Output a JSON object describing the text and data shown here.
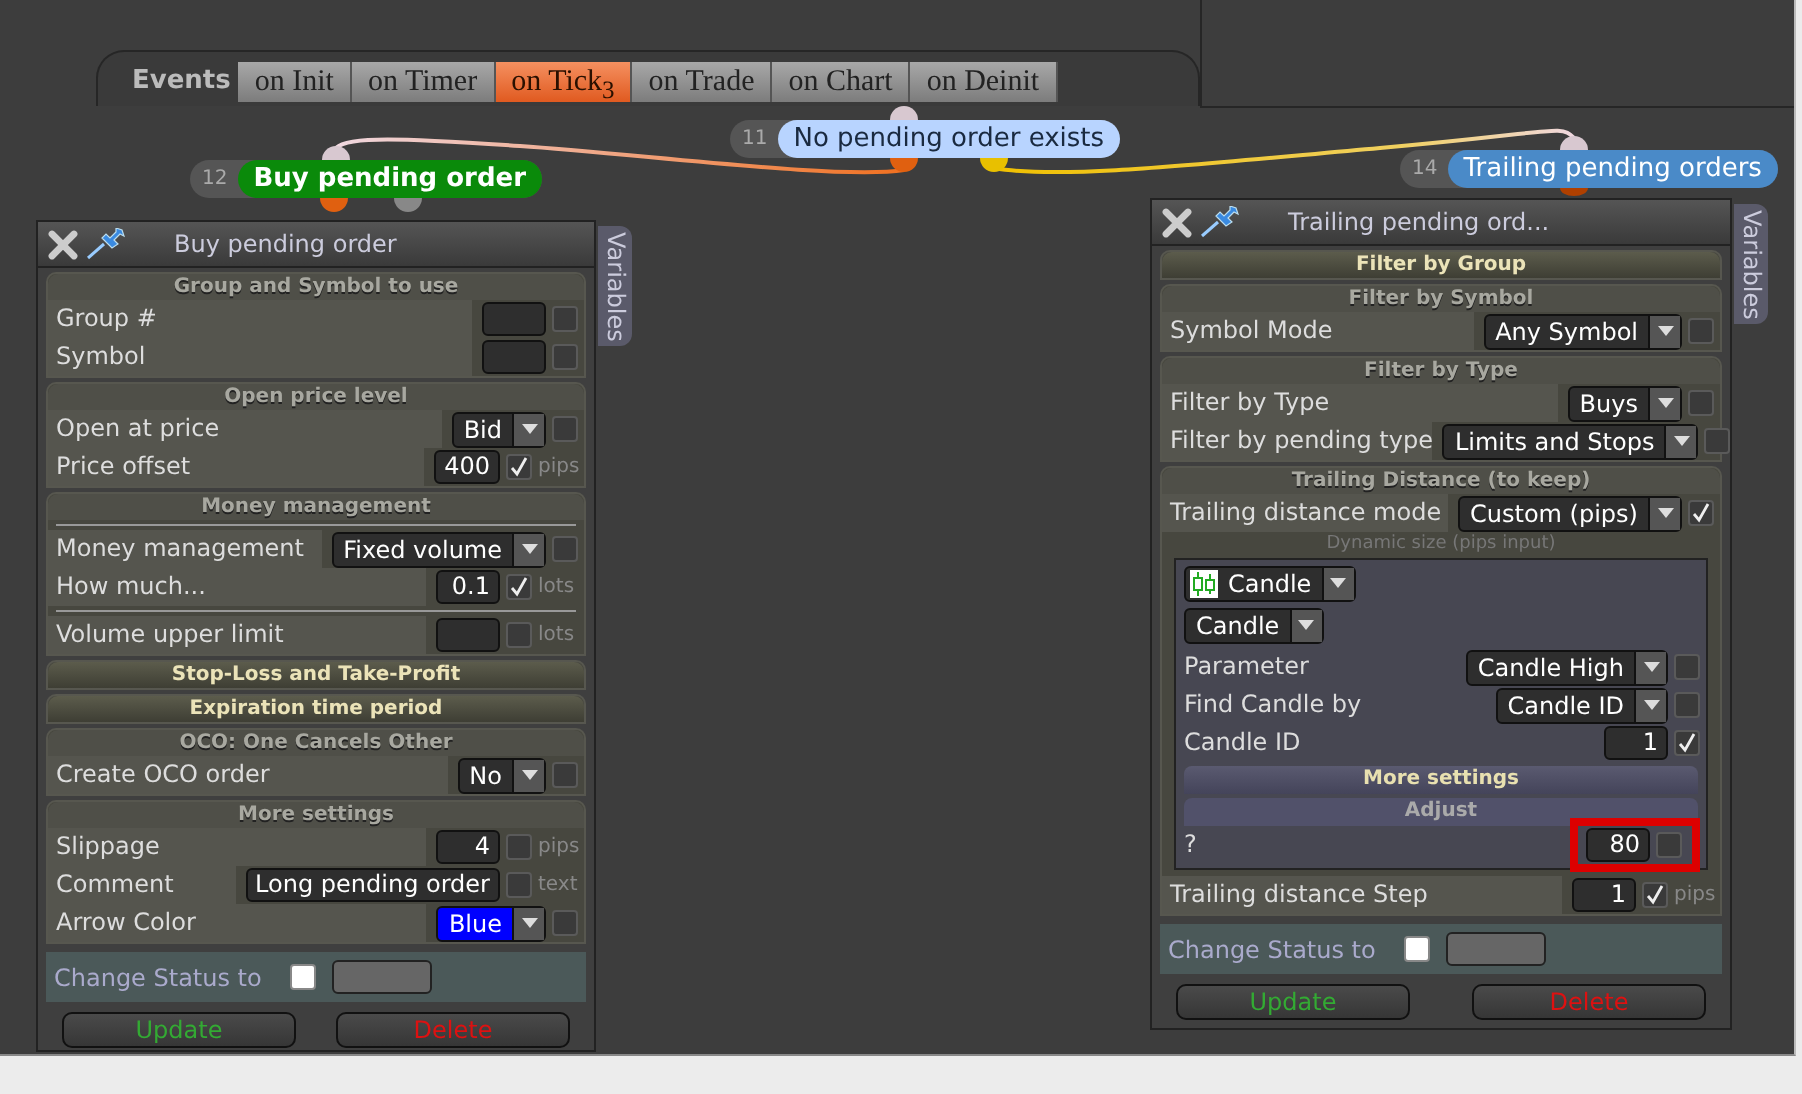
{
  "events_bar": {
    "label": "Events",
    "tabs": [
      {
        "label": "on Init",
        "selected": false
      },
      {
        "label": "on Timer",
        "selected": false
      },
      {
        "label": "on Tick$_{3}$",
        "selected": true
      },
      {
        "label": "on Trade",
        "selected": false
      },
      {
        "label": "on Chart",
        "selected": false
      },
      {
        "label": "on Deinit",
        "selected": false
      }
    ]
  },
  "nodes": [
    {
      "number": "12",
      "label": "Buy pending order",
      "color": "#0a8a0a",
      "selected": true
    },
    {
      "number": "11",
      "label": "No pending order exists",
      "color": "#b8d4ff",
      "selected": false
    },
    {
      "number": "14",
      "label": "Trailing pending orders",
      "color": "#4a8ac8",
      "selected": false
    }
  ],
  "panels": [
    {
      "title": "Buy pending order",
      "side_tab": "Variables",
      "sections": [
        {
          "title": "Group and Symbol to use",
          "expanded": true,
          "rows": [
            {
              "kind": "input",
              "label": "Group #",
              "checked": false
            },
            {
              "kind": "input",
              "label": "Symbol",
              "checked": false
            }
          ]
        },
        {
          "title": "Open price level",
          "expanded": true,
          "rows": [
            {
              "kind": "select",
              "label": "Open at price",
              "value": "Bid",
              "checked": false
            },
            {
              "kind": "input",
              "label": "Price offset",
              "value": "400",
              "checked": true,
              "unit": "pips"
            }
          ]
        },
        {
          "title": "Money management",
          "expanded": true,
          "rows": [
            {
              "kind": "rule"
            },
            {
              "kind": "select",
              "label": "Money management",
              "value": "Fixed volume",
              "checked": false
            },
            {
              "kind": "input",
              "label": "How much...",
              "value": "0.1",
              "checked": true,
              "unit": "lots"
            },
            {
              "kind": "rule"
            },
            {
              "kind": "input",
              "label": "Volume upper limit",
              "checked": false,
              "unit": "lots"
            }
          ]
        },
        {
          "title": "Stop-Loss and Take-Profit",
          "expanded": false
        },
        {
          "title": "Expiration time period",
          "expanded": false
        },
        {
          "title": "OCO: One Cancels Other",
          "expanded": true,
          "rows": [
            {
              "kind": "select",
              "label": "Create OCO order",
              "value": "No",
              "checked": false
            }
          ]
        },
        {
          "title": "More settings",
          "expanded": true,
          "rows": [
            {
              "kind": "input",
              "label": "Slippage",
              "value": "4",
              "checked": false,
              "unit": "pips"
            },
            {
              "kind": "input",
              "label": "Comment",
              "value": "Long pending order",
              "checked": false,
              "unit": "text"
            },
            {
              "kind": "select",
              "label": "Arrow Color",
              "value": "Blue",
              "checked": false,
              "color": "#0000ff"
            }
          ]
        }
      ],
      "status": {
        "label": "Change Status to",
        "checked": false
      },
      "buttons": [
        {
          "label": "Update",
          "kind": "update"
        },
        {
          "label": "Delete",
          "kind": "delete"
        }
      ]
    },
    {
      "title": "Trailing pending ord...",
      "side_tab": "Variables",
      "sections": [
        {
          "title": "Filter by Group",
          "expanded": false
        },
        {
          "title": "Filter by Symbol",
          "expanded": true,
          "rows": [
            {
              "kind": "select",
              "label": "Symbol Mode",
              "value": "Any Symbol",
              "checked": false
            }
          ]
        },
        {
          "title": "Filter by Type",
          "expanded": true,
          "rows": [
            {
              "kind": "select",
              "label": "Filter by Type",
              "value": "Buys",
              "checked": false
            },
            {
              "kind": "select",
              "label": "Filter by pending type",
              "value": "Limits and Stops",
              "checked": false
            }
          ]
        },
        {
          "title": "Trailing Distance (to keep)",
          "expanded": true,
          "rows": [
            {
              "kind": "select",
              "label": "Trailing distance mode",
              "value": "Custom (pips)",
              "checked": true
            },
            {
              "kind": "caption",
              "text": "Dynamic size (pips input)"
            },
            {
              "kind": "group",
              "rows": [
                {
                  "kind": "candle_select",
                  "value": "Candle"
                },
                {
                  "kind": "plain_select",
                  "value": "Candle"
                },
                {
                  "kind": "select",
                  "label": "Parameter",
                  "value": "Candle High",
                  "checked": false
                },
                {
                  "kind": "select",
                  "label": "Find Candle by",
                  "value": "Candle ID",
                  "checked": false
                },
                {
                  "kind": "input",
                  "label": "Candle ID",
                  "value": "1",
                  "checked": true
                },
                {
                  "kind": "header",
                  "title": "More settings",
                  "expanded": false
                },
                {
                  "kind": "header",
                  "title": "Adjust",
                  "expanded": true
                },
                {
                  "kind": "input",
                  "label": "?",
                  "value": "80",
                  "checked": false,
                  "highlighted": true
                }
              ]
            },
            {
              "kind": "input",
              "label": "Trailing distance Step",
              "value": "1",
              "checked": true,
              "unit": "pips"
            }
          ]
        }
      ],
      "status": {
        "label": "Change Status to",
        "checked": false
      },
      "buttons": [
        {
          "label": "Update",
          "kind": "update"
        },
        {
          "label": "Delete",
          "kind": "delete"
        }
      ]
    }
  ]
}
